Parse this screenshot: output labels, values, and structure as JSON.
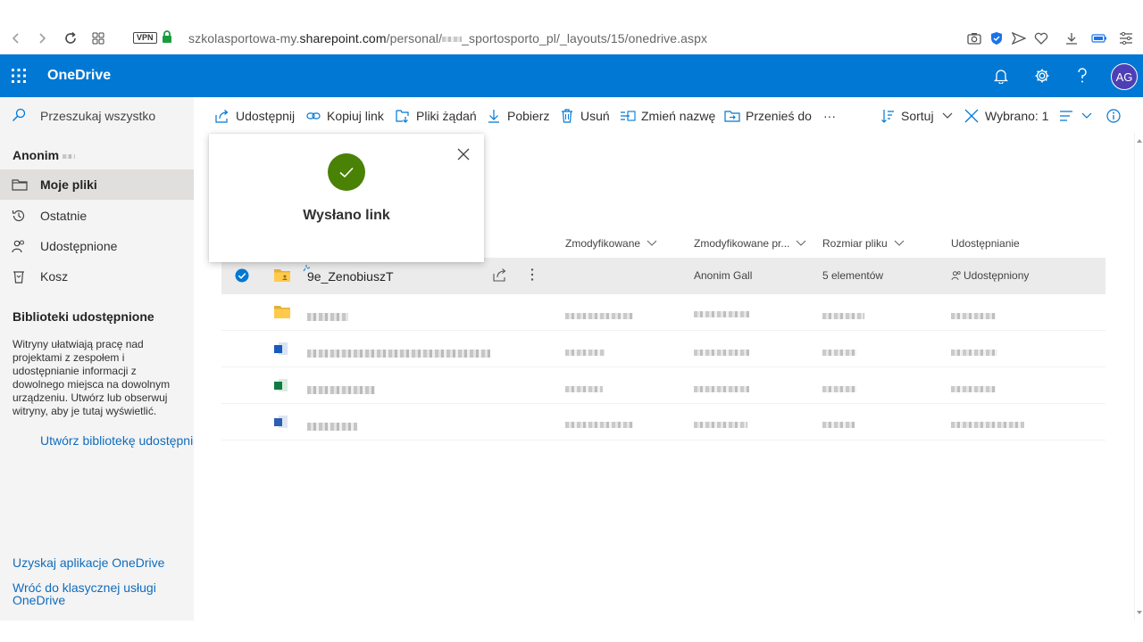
{
  "browser": {
    "url_host_prefix": "szkolasportowa-my.",
    "url_host": "sharepoint.com",
    "url_path": "/personal/",
    "url_path_rest": "_sportosporto_pl/_layouts/15/onedrive.aspx",
    "vpn_label": "VPN"
  },
  "header": {
    "brand": "OneDrive",
    "avatar_initials": "AG",
    "accent_color": "#0078d4"
  },
  "leftnav": {
    "search_label": "Przeszukaj wszystko",
    "user_name": "Anonim",
    "items": [
      {
        "label": "Moje pliki",
        "icon": "folder-icon",
        "active": true
      },
      {
        "label": "Ostatnie",
        "icon": "history-icon",
        "active": false
      },
      {
        "label": "Udostępnione",
        "icon": "people-icon",
        "active": false
      },
      {
        "label": "Kosz",
        "icon": "recycle-bin-icon",
        "active": false
      }
    ],
    "shared_libraries_title": "Biblioteki udostępnione",
    "shared_libraries_desc": "Witryny ułatwiają pracę nad projektami z zespołem i udostępnianie informacji z dowolnego miejsca na dowolnym urządzeniu. Utwórz lub obserwuj witryny, aby je tutaj wyświetlić.",
    "create_library_link": "Utwórz bibliotekę udostępnioną",
    "get_app_link": "Uzyskaj aplikacje OneDrive",
    "classic_link": "Wróć do klasycznej usługi OneDrive"
  },
  "commandbar": {
    "share": "Udostępnij",
    "copy_link": "Kopiuj link",
    "request_files": "Pliki żądań",
    "download": "Pobierz",
    "delete": "Usuń",
    "rename": "Zmień nazwę",
    "move_to": "Przenieś do",
    "more": "···",
    "sort": "Sortuj",
    "selected": "Wybrano: 1"
  },
  "columns": {
    "modified": "Zmodyfikowane",
    "modified_by": "Zmodyfikowane pr...",
    "file_size": "Rozmiar pliku",
    "sharing": "Udostępnianie"
  },
  "rows": [
    {
      "name": "9e_ZenobiuszT",
      "modified_by": "Anonim Gall",
      "size": "5 elementów",
      "sharing": "Udostępniony",
      "type": "folder",
      "selected": true
    }
  ],
  "popup": {
    "message": "Wysłano link",
    "success_color": "#498205"
  }
}
